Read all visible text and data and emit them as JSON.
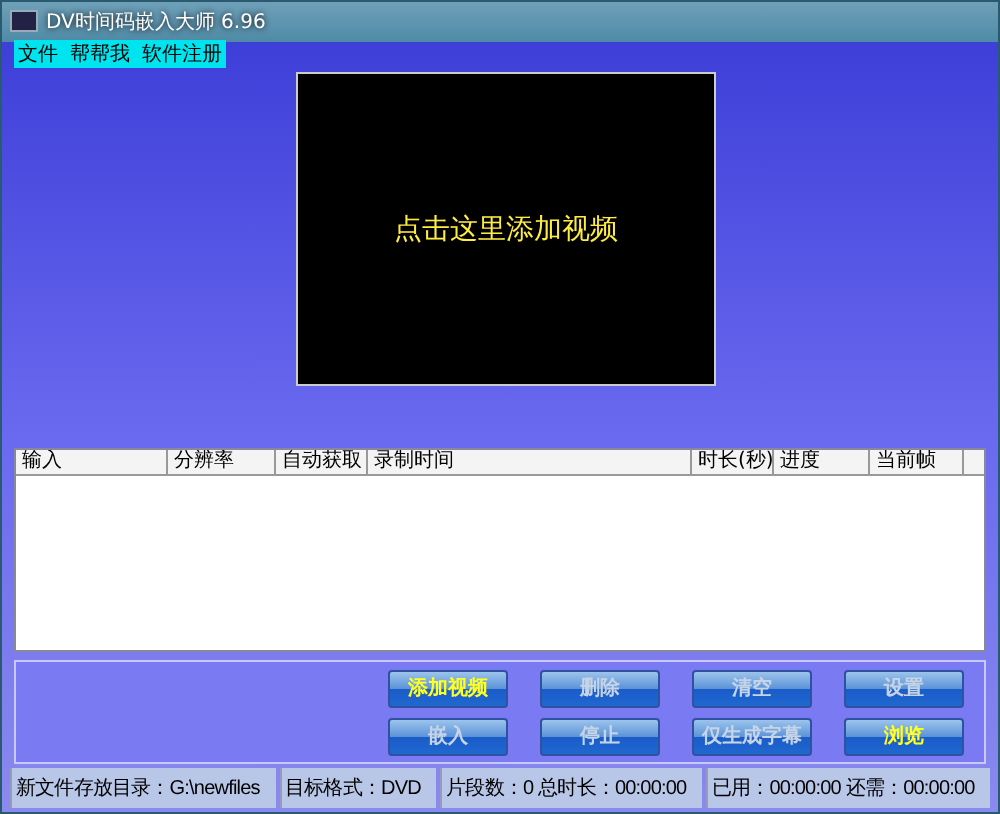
{
  "window": {
    "title": "DV时间码嵌入大师  6.96"
  },
  "menu": [
    "文件",
    "帮帮我",
    "软件注册"
  ],
  "preview": {
    "prompt": "点击这里添加视频"
  },
  "table": {
    "columns": [
      "输入",
      "分辨率",
      "自动获取",
      "录制时间",
      "时长(秒)",
      "进度",
      "当前帧"
    ]
  },
  "buttons": [
    {
      "label": "添加视频",
      "disabled": false
    },
    {
      "label": "删除",
      "disabled": true
    },
    {
      "label": "清空",
      "disabled": true
    },
    {
      "label": "设置",
      "disabled": true
    },
    {
      "label": "嵌入",
      "disabled": true
    },
    {
      "label": "停止",
      "disabled": true
    },
    {
      "label": "仅生成字幕",
      "disabled": true
    },
    {
      "label": "浏览",
      "disabled": false
    }
  ],
  "status_bar": [
    "新文件存放目录：G:\\newfiles",
    "目标格式：DVD",
    "片段数：0  总时长：00:00:00",
    "已用：00:00:00 还需：00:00:00"
  ]
}
